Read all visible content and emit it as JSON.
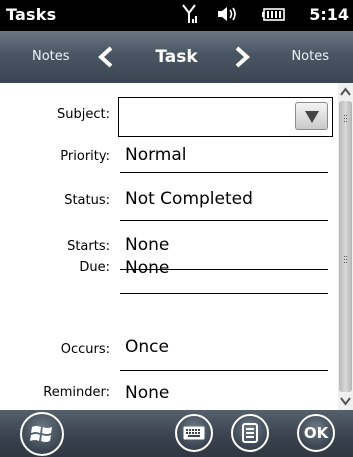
{
  "status_bar": {
    "app_title": "Tasks",
    "time": "5:14",
    "icons": [
      "signal-icon",
      "volume-icon",
      "battery-icon"
    ]
  },
  "nav": {
    "left_label": "Notes",
    "title": "Task",
    "right_label": "Notes"
  },
  "form": {
    "subject": {
      "label": "Subject:",
      "value": ""
    },
    "priority": {
      "label": "Priority:",
      "value": "Normal"
    },
    "status": {
      "label": "Status:",
      "value": "Not Completed"
    },
    "starts": {
      "label": "Starts:",
      "value": "None"
    },
    "due": {
      "label": "Due:",
      "value": "None"
    },
    "occurs": {
      "label": "Occurs:",
      "value": "Once"
    },
    "reminder": {
      "label": "Reminder:",
      "value": "None"
    }
  },
  "toolbar": {
    "ok_label": "OK",
    "icons": [
      "windows-start-icon",
      "keyboard-icon",
      "menu-icon"
    ]
  },
  "colors": {
    "nav_bar": "#4a5564",
    "toolbar": "#3a434f",
    "status_bar": "#000000"
  }
}
